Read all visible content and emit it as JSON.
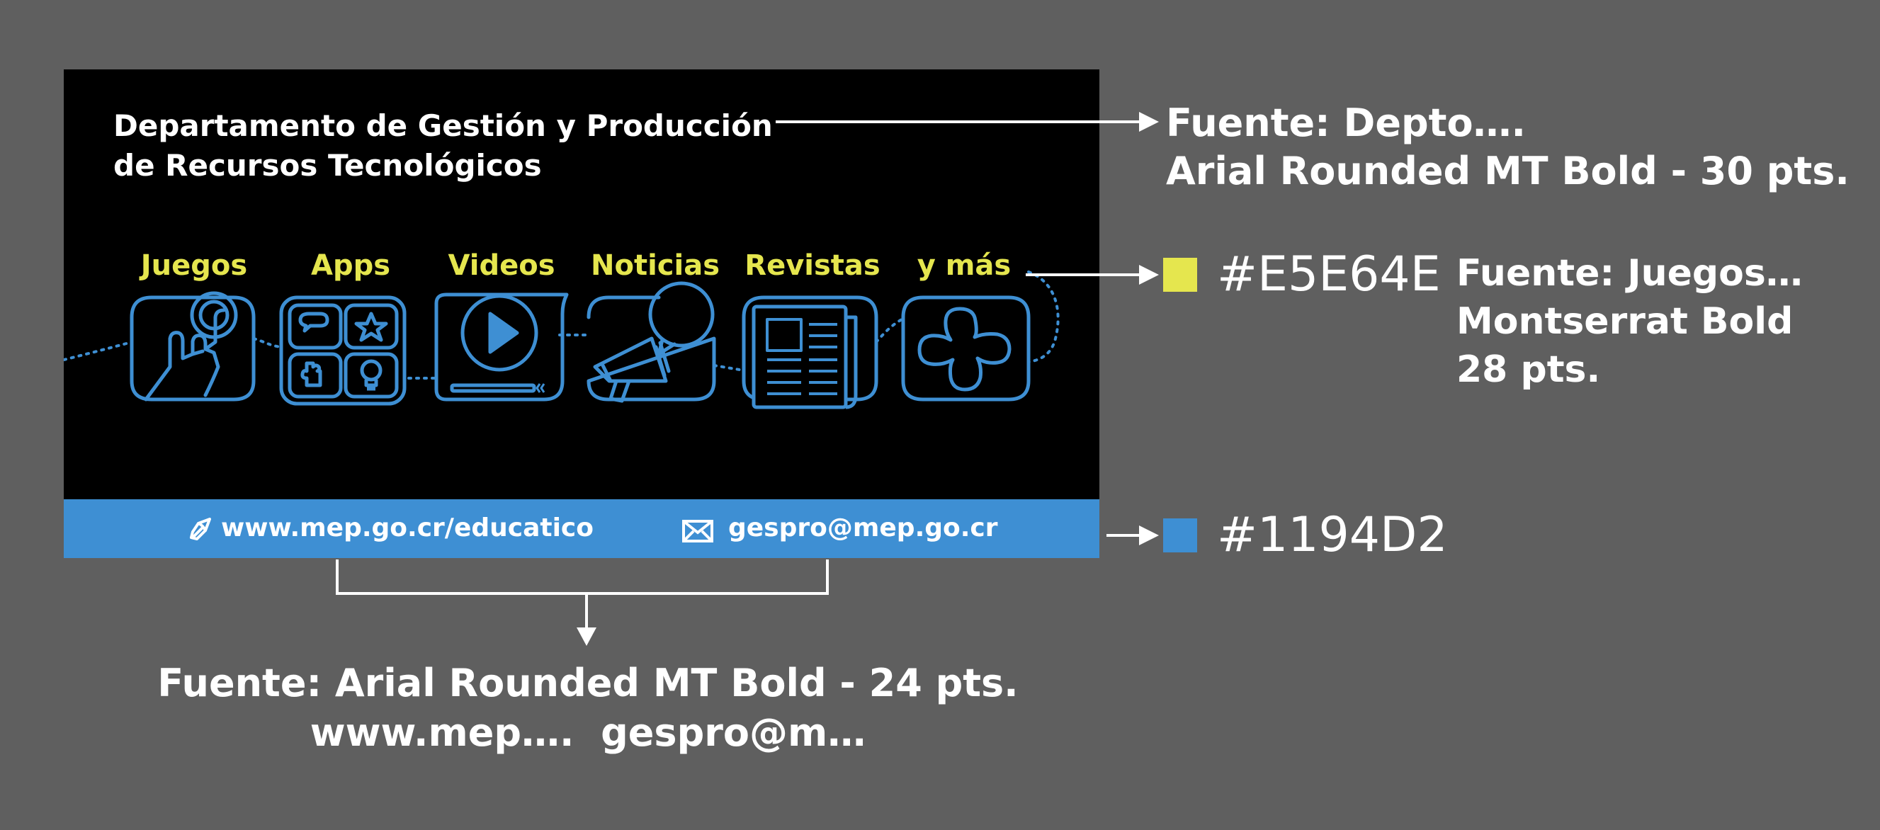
{
  "banner": {
    "title_line1": "Departamento de Gestión y Producción",
    "title_line2": "de Recursos Tecnológicos",
    "categories": [
      "Juegos",
      "Apps",
      "Videos",
      "Noticias",
      "Revistas",
      "y más"
    ],
    "footer": {
      "website": "www.mep.go.cr/educatico",
      "email": "gespro@mep.go.cr",
      "website_icon": "link-arrow-icon",
      "email_icon": "envelope-icon"
    },
    "icons": [
      "touch-hand-icon",
      "apps-grid-icon",
      "video-play-icon",
      "megaphone-icon",
      "newspaper-icon",
      "puzzle-cross-icon"
    ]
  },
  "annotations": {
    "title_font": {
      "line1": "Fuente: Depto….",
      "line2": "Arial Rounded MT Bold - 30 pts."
    },
    "category_color": "#E5E64E",
    "category_font": {
      "line1": "Fuente: Juegos…",
      "line2": "Montserrat Bold",
      "line3": "28 pts."
    },
    "footer_color": "#1194D2",
    "footer_font": {
      "line1": "Fuente: Arial Rounded MT Bold - 24 pts.",
      "line2": "www.mep….  gespro@m…"
    }
  },
  "colors": {
    "background": "#5f5f5f",
    "banner_bg": "#000000",
    "accent_yellow": "#E5E64E",
    "accent_blue": "#1194D2",
    "icon_blue": "#3e8fd3"
  }
}
